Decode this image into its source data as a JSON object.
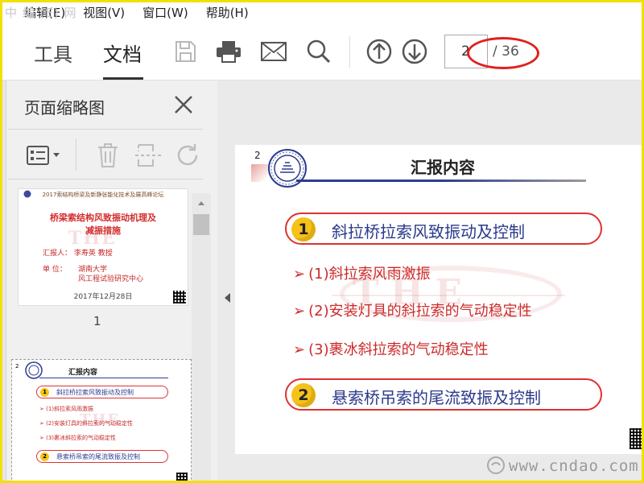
{
  "watermark_top": "中 编 (E) 网",
  "menu": {
    "items": [
      "编辑(E)",
      "视图(V)",
      "窗口(W)",
      "帮助(H)"
    ]
  },
  "toolbar": {
    "tab_tools": "工具",
    "tab_document": "文档",
    "icons": [
      "save-icon",
      "print-icon",
      "email-icon",
      "search-icon",
      "page-up-icon",
      "page-down-icon"
    ],
    "page_current": "2",
    "page_total": "/ 36",
    "highlight_color": "#e02020"
  },
  "left_panel": {
    "title": "页面缩略图",
    "tools": [
      "thumbnail-options-icon",
      "delete-icon",
      "extract-pages-icon",
      "rotate-icon"
    ],
    "thumbnails": [
      {
        "page_label": "1",
        "header": "2017索结构桥梁及新静张能化技术及展高峰论坛",
        "title_line1": "桥梁索结构风致振动机理及",
        "title_line2": "减振措施",
        "reporter": "汇报人：  李寿英 教授",
        "unit_label": "单  位：",
        "unit_line1": "湖南大学",
        "unit_line2": "风工程试验研究中心",
        "date": "2017年12月28日",
        "watermark": "THE"
      },
      {
        "page_label": "2",
        "title": "汇报内容",
        "item1": "斜拉桥拉索风致振动及控制",
        "sub1": "➢ (1)斜拉索风雨激振",
        "sub2": "➢ (2)安装灯具的斜拉索的气动稳定性",
        "sub3": "➢ (3)裹冰斜拉索的气动稳定性",
        "item2": "悬索桥吊索的尾流致振及控制"
      }
    ]
  },
  "slide": {
    "page_number": "2",
    "title": "汇报内容",
    "items": [
      {
        "num": "1",
        "text": "斜拉桥拉索风致振动及控制"
      },
      {
        "num": "2",
        "text": "悬索桥吊索的尾流致振及控制"
      }
    ],
    "subitems": [
      "(1)斜拉索风雨激振",
      "(2)安装灯具的斜拉索的气动稳定性",
      "(3)裹冰斜拉索的气动稳定性"
    ],
    "watermark": "THE",
    "accent_red": "#e03030",
    "accent_blue": "#2b3a8c",
    "number_badge_color": "#f6c21a"
  },
  "site_watermark": "www.cndao.com"
}
